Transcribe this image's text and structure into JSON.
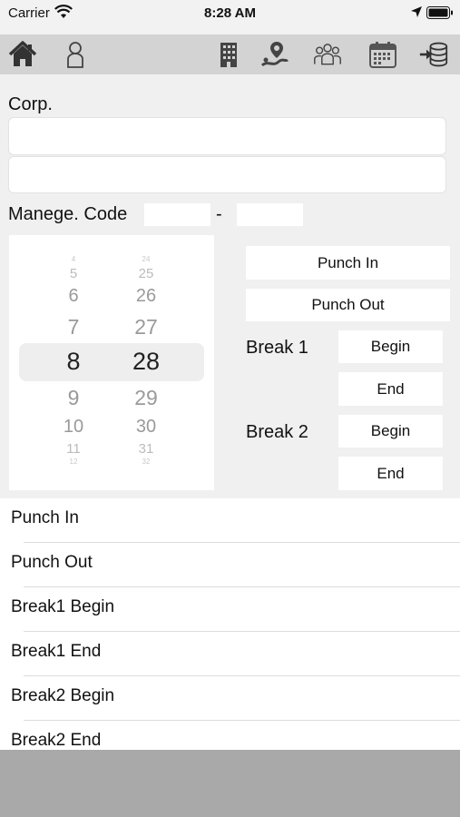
{
  "status_bar": {
    "carrier": "Carrier",
    "time": "8:28 AM"
  },
  "toolbar": {
    "icons": [
      "home-icon",
      "person-icon",
      "building-icon",
      "map-pin-icon",
      "group-icon",
      "calendar-icon",
      "database-import-icon"
    ]
  },
  "form": {
    "corp_label": "Corp.",
    "corp_field_1": "",
    "corp_field_2": "",
    "manage_code_label": "Manege. Code",
    "code_separator": "-",
    "code_field_1": "",
    "code_field_2": ""
  },
  "time_picker": {
    "hours": [
      "4",
      "5",
      "6",
      "7",
      "8",
      "9",
      "10",
      "11",
      "12"
    ],
    "minutes": [
      "24",
      "25",
      "26",
      "27",
      "28",
      "29",
      "30",
      "31",
      "32"
    ],
    "selected_hour": "8",
    "selected_minute": "28"
  },
  "actions": {
    "punch_in": "Punch In",
    "punch_out": "Punch Out",
    "break1_label": "Break 1",
    "break1_begin": "Begin",
    "break1_end": "End",
    "break2_label": "Break 2",
    "break2_begin": "Begin",
    "break2_end": "End"
  },
  "records": [
    {
      "label": "Punch In"
    },
    {
      "label": "Punch Out"
    },
    {
      "label": "Break1 Begin"
    },
    {
      "label": "Break1 End"
    },
    {
      "label": "Break2 Begin"
    },
    {
      "label": "Break2 End"
    }
  ]
}
